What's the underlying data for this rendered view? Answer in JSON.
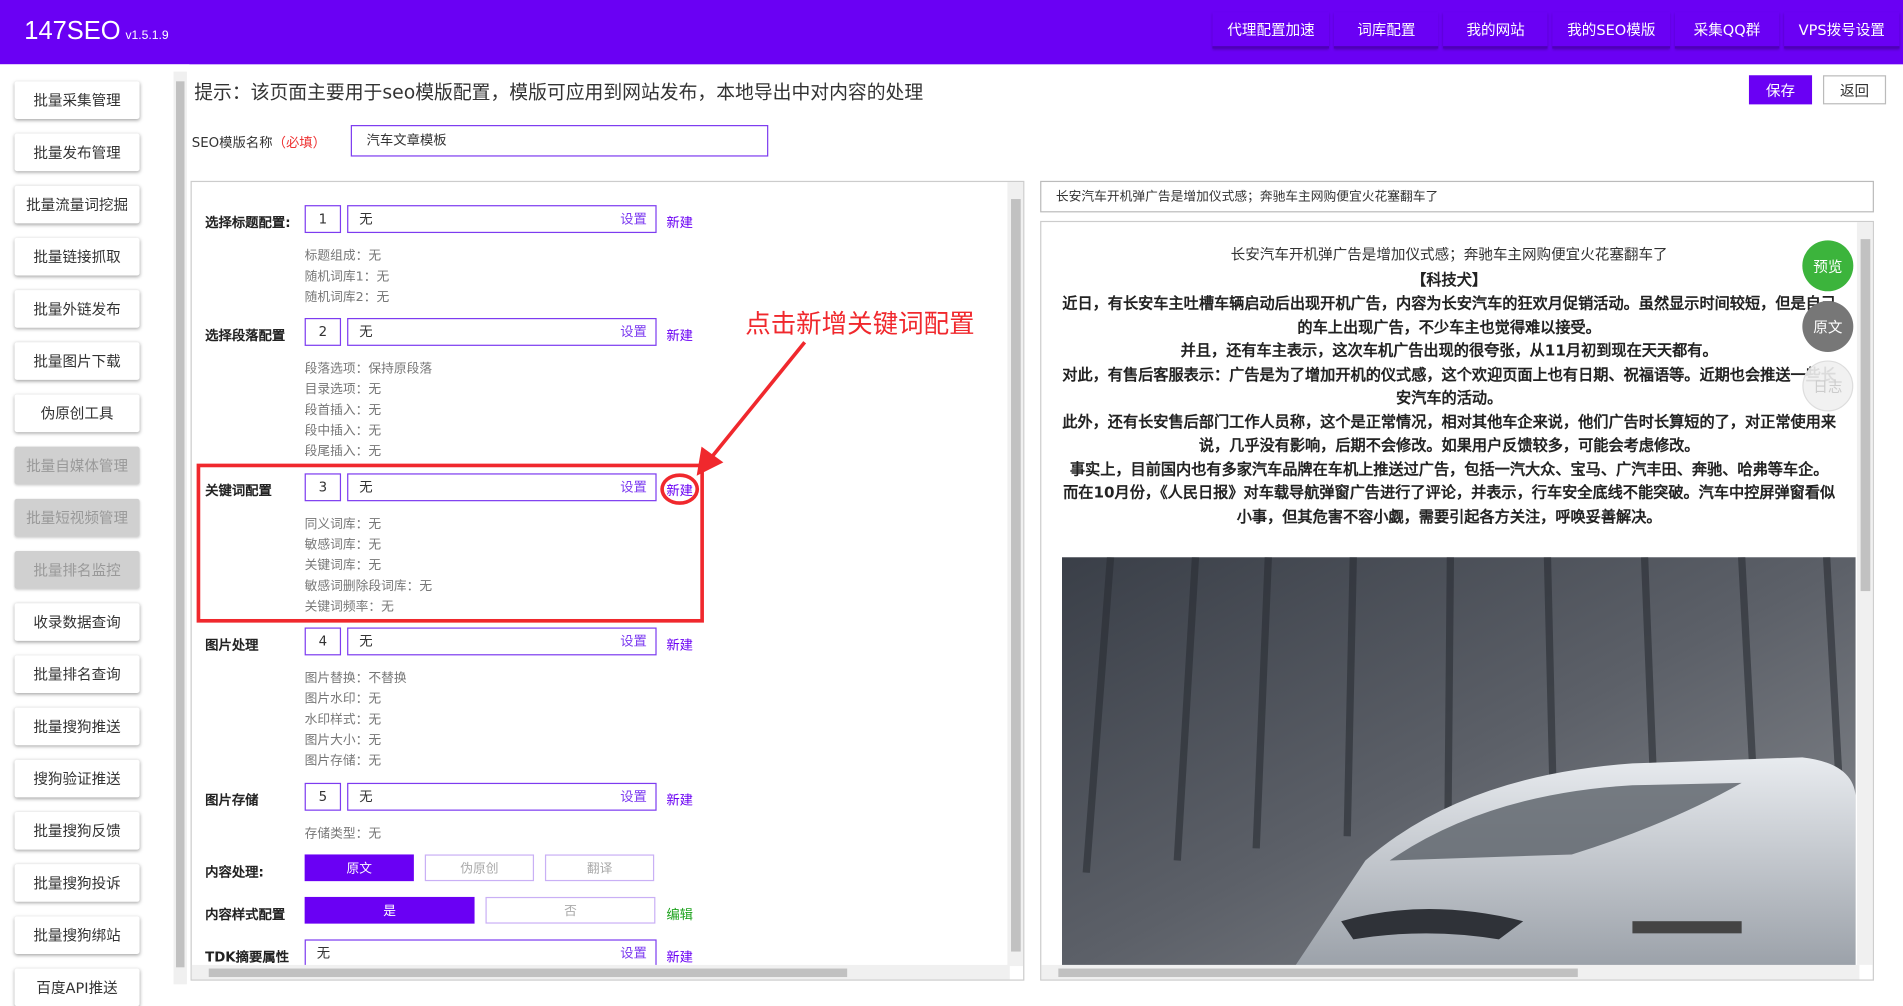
{
  "app": {
    "title": "147SEO",
    "version": "v1.5.1.9"
  },
  "topnav": [
    {
      "label": "代理配置加速"
    },
    {
      "label": "词库配置"
    },
    {
      "label": "我的网站"
    },
    {
      "label": "我的SEO模版"
    },
    {
      "label": "采集QQ群"
    },
    {
      "label": "VPS拨号设置"
    }
  ],
  "sidebar": [
    {
      "label": "批量采集管理",
      "disabled": false
    },
    {
      "label": "批量发布管理",
      "disabled": false
    },
    {
      "label": "批量流量词挖掘",
      "disabled": false
    },
    {
      "label": "批量链接抓取",
      "disabled": false
    },
    {
      "label": "批量外链发布",
      "disabled": false
    },
    {
      "label": "批量图片下载",
      "disabled": false
    },
    {
      "label": "伪原创工具",
      "disabled": false
    },
    {
      "label": "批量自媒体管理",
      "disabled": true
    },
    {
      "label": "批量短视频管理",
      "disabled": true
    },
    {
      "label": "批量排名监控",
      "disabled": true
    },
    {
      "label": "收录数据查询",
      "disabled": false
    },
    {
      "label": "批量排名查询",
      "disabled": false
    },
    {
      "label": "批量搜狗推送",
      "disabled": false
    },
    {
      "label": "搜狗验证推送",
      "disabled": false
    },
    {
      "label": "批量搜狗反馈",
      "disabled": false
    },
    {
      "label": "批量搜狗投诉",
      "disabled": false
    },
    {
      "label": "批量搜狗绑站",
      "disabled": false
    },
    {
      "label": "百度API推送",
      "disabled": false
    }
  ],
  "page": {
    "hint": "提示：该页面主要用于seo模版配置，模版可应用到网站发布，本地导出中对内容的处理",
    "save_label": "保存",
    "back_label": "返回",
    "name_label": "SEO模版名称",
    "name_required": "（必填）",
    "name_value": "汽车文章模板"
  },
  "config": {
    "set_label": "设置",
    "new_label": "新建",
    "sections": [
      {
        "label": "选择标题配置:",
        "num": "1",
        "value": "无",
        "subs": [
          "标题组成：无",
          "随机词库1：无",
          "随机词库2：无"
        ]
      },
      {
        "label": "选择段落配置",
        "num": "2",
        "value": "无",
        "subs": [
          "段落选项：保持原段落",
          "目录选项：无",
          "段首插入：无",
          "段中插入：无",
          "段尾插入：无"
        ]
      },
      {
        "label": "关键词配置",
        "num": "3",
        "value": "无",
        "subs": [
          "同义词库：无",
          "敏感词库：无",
          "关键词库：无",
          "敏感词删除段词库：无",
          "关键词频率：无"
        ]
      },
      {
        "label": "图片处理",
        "num": "4",
        "value": "无",
        "subs": [
          "图片替换：不替换",
          "图片水印：无",
          "水印样式：无",
          "图片大小：无",
          "图片存储：无"
        ]
      },
      {
        "label": "图片存储",
        "num": "5",
        "value": "无",
        "subs": [
          "存储类型：无"
        ]
      }
    ],
    "content_process": {
      "label": "内容处理:",
      "options": [
        "原文",
        "伪原创",
        "翻译"
      ]
    },
    "content_style": {
      "label": "内容样式配置",
      "options": [
        "是",
        "否"
      ],
      "edit_label": "编辑"
    },
    "tdk": {
      "label": "TDK摘要属性",
      "value": "无"
    }
  },
  "annotation": {
    "text": "点击新增关键词配置"
  },
  "preview": {
    "title_value": "长安汽车开机弹广告是增加仪式感；奔驰车主网购便宜火花塞翻车了",
    "article_title": "长安汽车开机弹广告是增加仪式感；奔驰车主网购便宜火花塞翻车了",
    "tag": "【科技犬】",
    "paragraphs": [
      "近日，有长安车主吐槽车辆启动后出现开机广告，内容为长安汽车的狂欢月促销活动。虽然显示时间较短，但是自己的车上出现广告，不少车主也觉得难以接受。",
      "并且，还有车主表示，这次车机广告出现的很夸张，从11月初到现在天天都有。",
      "对此，有售后客服表示：广告是为了增加开机的仪式感，这个欢迎页面上也有日期、祝福语等。近期也会推送一些长安汽车的活动。",
      "此外，还有长安售后部门工作人员称，这个是正常情况，相对其他车企来说，他们广告时长算短的了，对正常使用来说，几乎没有影响，后期不会修改。如果用户反馈较多，可能会考虑修改。",
      "事实上，目前国内也有多家汽车品牌在车机上推送过广告，包括一汽大众、宝马、广汽丰田、奔驰、哈弗等车企。",
      "而在10月份，《人民日报》对车载导航弹窗广告进行了评论，并表示，行车安全底线不能突破。汽车中控屏弹窗看似小事，但其危害不容小觑，需要引起各方关注，呼唤妥善解决。"
    ],
    "float_buttons": {
      "preview": "预览",
      "original": "原文",
      "log": "日志"
    }
  },
  "colors": {
    "brand": "#6a00f4",
    "highlight": "#f0282d",
    "preview_green": "#3cb43c"
  }
}
